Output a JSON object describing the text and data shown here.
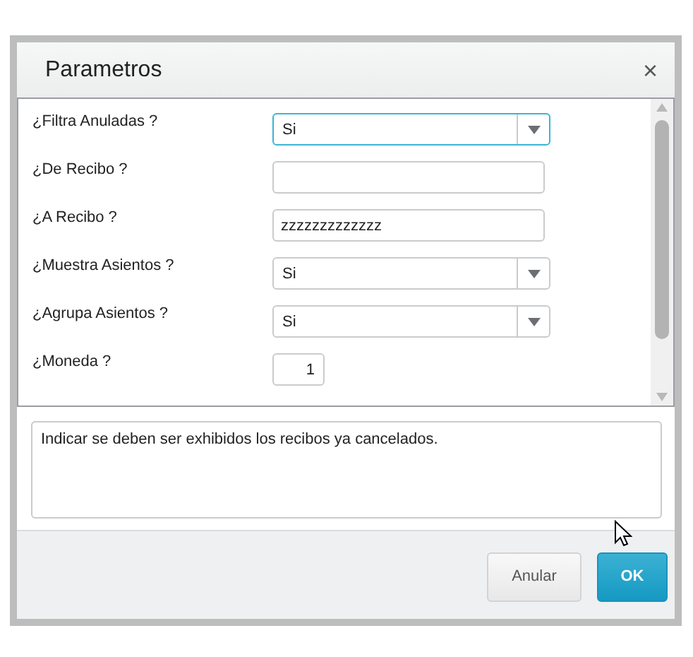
{
  "dialog": {
    "title": "Parametros",
    "close": "×"
  },
  "fields": [
    {
      "label": "¿Filtra Anuladas ?",
      "kind": "select",
      "value": "Si",
      "focused": true
    },
    {
      "label": "¿De Recibo ?",
      "kind": "text",
      "focused": false
    },
    {
      "label": "¿A Recibo ?",
      "kind": "text",
      "value": "zzzzzzzzzzzzz",
      "focused": false
    },
    {
      "label": "¿Muestra Asientos ?",
      "kind": "select",
      "value": "Si",
      "focused": false
    },
    {
      "label": "¿Agrupa Asientos ?",
      "kind": "select",
      "value": "Si",
      "focused": false
    },
    {
      "label": "¿Moneda ?",
      "kind": "number",
      "value": "1",
      "focused": false
    }
  ],
  "help": "Indicar se deben ser exhibidos los recibos ya cancelados.",
  "buttons": [
    {
      "label": "Anular",
      "kind": "secondary"
    },
    {
      "label": "OK",
      "kind": "primary"
    }
  ]
}
